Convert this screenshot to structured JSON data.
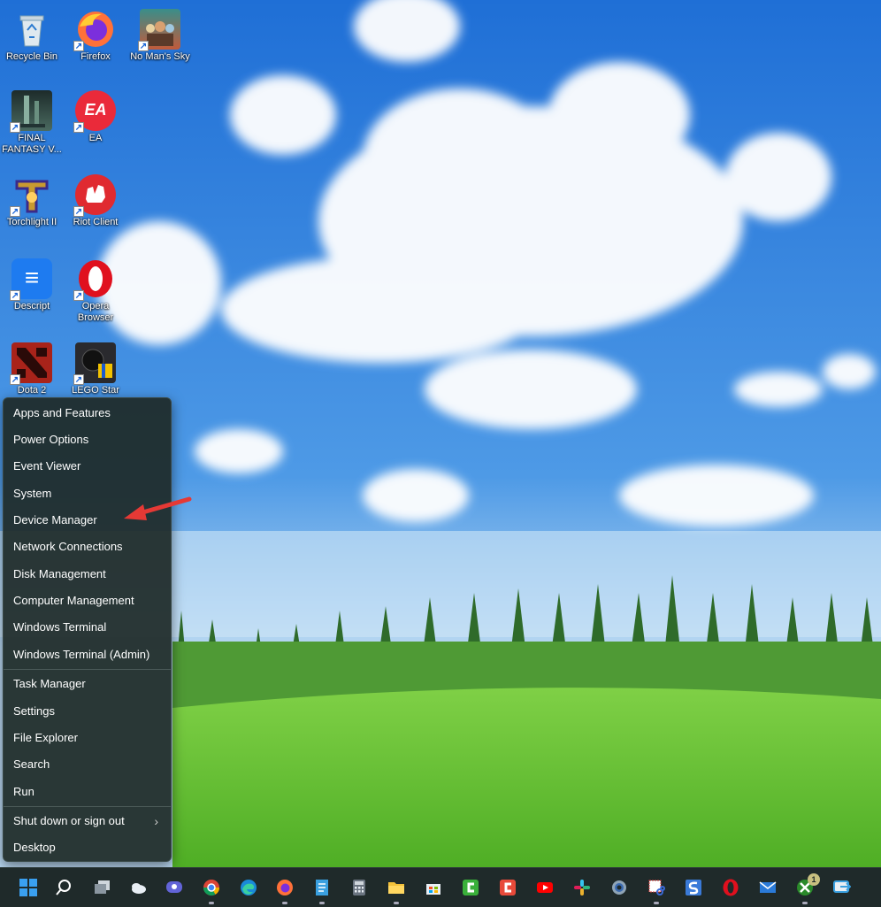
{
  "desktop": {
    "icons": [
      {
        "label": "Recycle Bin"
      },
      {
        "label": "Firefox"
      },
      {
        "label": "No Man's Sky"
      },
      {
        "label": "FINAL FANTASY V..."
      },
      {
        "label": "EA"
      },
      {
        "label": "Torchlight II"
      },
      {
        "label": "Riot Client"
      },
      {
        "label": "Descript"
      },
      {
        "label": "Opera Browser"
      },
      {
        "label": "Dota 2"
      },
      {
        "label": "LEGO Star"
      }
    ]
  },
  "icon_text": {
    "ea": "EA",
    "descript": "≡",
    "shortcut": "↗"
  },
  "winx_menu": {
    "items": [
      {
        "label": "Apps and Features"
      },
      {
        "label": "Power Options"
      },
      {
        "label": "Event Viewer"
      },
      {
        "label": "System"
      },
      {
        "label": "Device Manager"
      },
      {
        "label": "Network Connections"
      },
      {
        "label": "Disk Management"
      },
      {
        "label": "Computer Management"
      },
      {
        "label": "Windows Terminal"
      },
      {
        "label": "Windows Terminal (Admin)"
      },
      {
        "label": "Task Manager"
      },
      {
        "label": "Settings"
      },
      {
        "label": "File Explorer"
      },
      {
        "label": "Search"
      },
      {
        "label": "Run"
      },
      {
        "label": "Shut down or sign out"
      },
      {
        "label": "Desktop"
      }
    ],
    "submenu_glyph": "›"
  },
  "taskbar": {
    "xbox_badge": "1",
    "icons": [
      "start-icon",
      "search-icon",
      "task-view-icon",
      "onedrive-icon",
      "teams-chat-icon",
      "chrome-icon",
      "edge-icon",
      "firefox-icon",
      "notepad-icon",
      "calculator-icon",
      "file-explorer-icon",
      "microsoft-store-icon",
      "camtasia-icon",
      "camtasia-recorder-icon",
      "youtube-icon",
      "slack-icon",
      "settings-gear-icon",
      "snipping-tool-icon",
      "simplenote-icon",
      "opera-icon",
      "mail-icon",
      "xbox-icon",
      "quick-share-icon"
    ]
  },
  "colors": {
    "sky": "#3b87e0",
    "grass": "#6cc43a",
    "menu_bg": "#1e2a28",
    "taskbar_bg": "#1f2a2a",
    "arrow": "#e53935"
  }
}
